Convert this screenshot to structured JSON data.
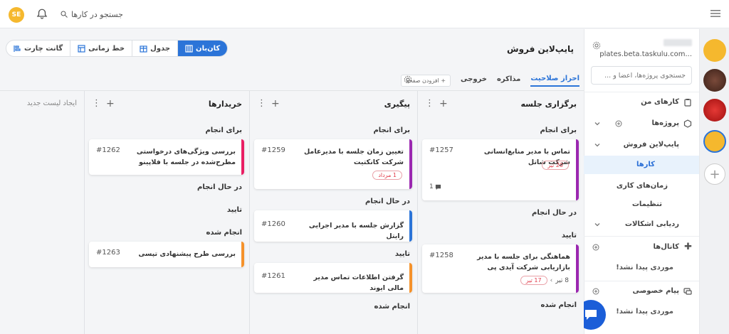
{
  "topbar": {
    "avatar_initials": "SE",
    "search_label": "جستجو در کارها"
  },
  "workspace": {
    "url": "plates.beta.taskulu.com...",
    "search_placeholder": "جستجوی پروژه‌ها، اعضا و ..."
  },
  "sidebar": {
    "my_tasks": "کارهای من",
    "projects": "پروژه‌ها",
    "project_name": "پایپ‌لاین فروش",
    "tasks": "کارها",
    "work_times": "زمان‌های کاری",
    "settings": "تنظیمات",
    "issue_tracking": "ردیابی اشکالات",
    "channels": "کانال‌ها",
    "channels_empty": "موردی پیدا نشد!",
    "private_messages": "پیام خصوصی",
    "private_empty": "موردی پیدا نشد!"
  },
  "main": {
    "title": "پایپ‌لاین فروش",
    "views": {
      "kanban": "کان‌بان",
      "table": "جدول",
      "timeline": "خط زمانی",
      "gantt": "گانت چارت"
    },
    "tabs": {
      "qualification": "احراز صلاحیت",
      "negotiation": "مذاکره",
      "output": "خروجی",
      "add_page": "+ افزودن صفحه"
    }
  },
  "board": {
    "columns": [
      {
        "title": "برگزاری جلسه",
        "groups": [
          "برای انجام",
          "در حال انجام",
          "تایید",
          "انجام شده"
        ],
        "cards": [
          {
            "title": "تماس با مدیر منابع‌انسانی شرکت شاتل",
            "number": "#1257",
            "badge": "20 تیر",
            "comments": "1"
          },
          {
            "title": "هماهنگی برای جلسه با مدیر بازاریابی شرکت آیدی پی",
            "number": "#1258",
            "badge": "17 تیر",
            "badge_from": "8 تیر"
          }
        ]
      },
      {
        "title": "پیگیری",
        "groups": [
          "برای انجام",
          "در حال انجام",
          "تایید",
          "انجام شده"
        ],
        "cards": [
          {
            "title": "تعیین زمان جلسه با مدیرعامل شرکت کانکتیت",
            "number": "#1259",
            "badge": "1 مرداد"
          },
          {
            "title": "گزارش جلسه با مدیر اجرایی رایتل",
            "number": "#1260"
          },
          {
            "title": "گرفتن اطلاعات تماس مدیر مالی ایوند",
            "number": "#1261"
          }
        ]
      },
      {
        "title": "خریدارها",
        "groups": [
          "برای انجام",
          "در حال انجام",
          "تایید",
          "انجام شده"
        ],
        "cards": [
          {
            "title": "بررسی ویژگی‌های درخواستی مطرح‌شده در جلسه با فلاپینو",
            "number": "#1262"
          },
          {
            "title": "بررسی طرح پیشنهادی تپسی",
            "number": "#1263"
          }
        ]
      }
    ],
    "new_list": "ایجاد لیست جدید"
  },
  "colors": {
    "accent": "#2b74d8",
    "stripe_purple": "#9b27b0",
    "stripe_blue": "#2b74d8",
    "stripe_orange": "#f5922b",
    "stripe_pink": "#e91e63",
    "badge_red": "#e23b4a"
  }
}
